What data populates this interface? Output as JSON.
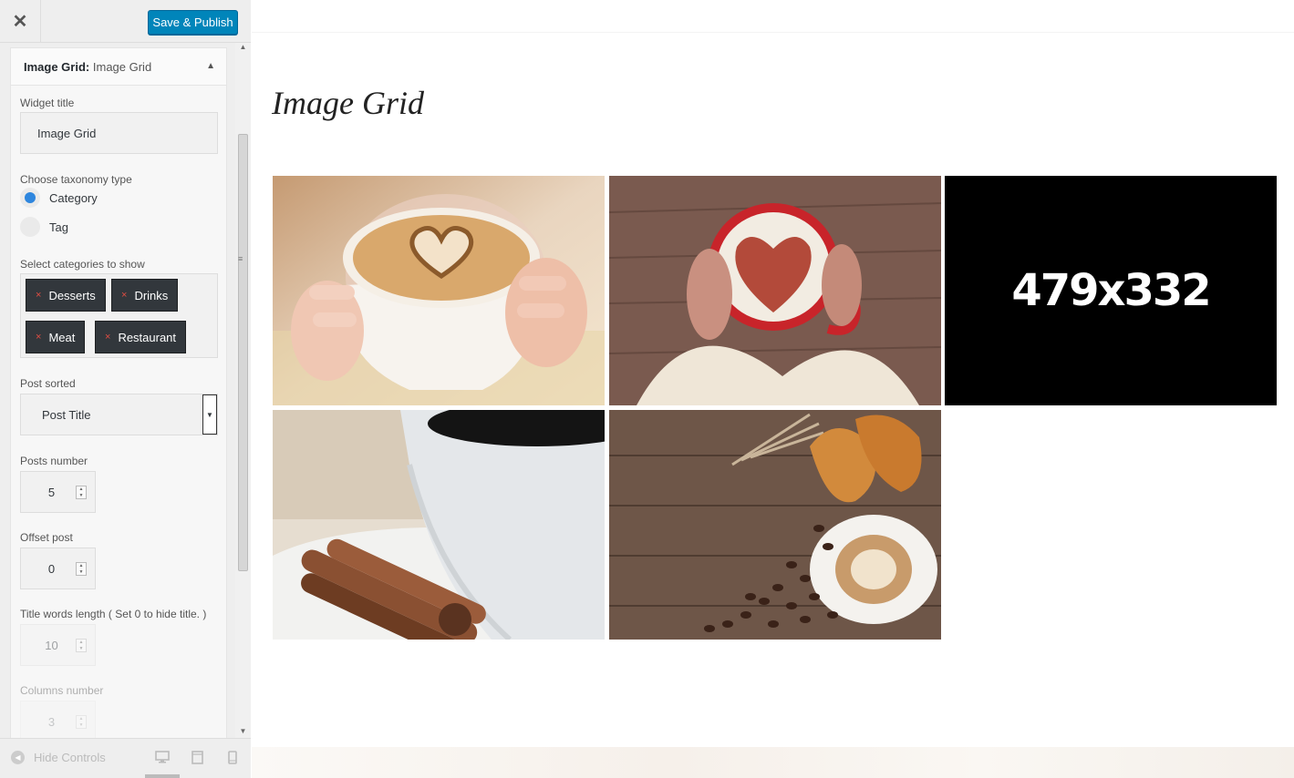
{
  "header": {
    "close_label": "✕",
    "publish_label": "Save & Publish"
  },
  "widget": {
    "title_bold": "Image Grid:",
    "title_name": "Image Grid",
    "toggle": "▲",
    "fields": {
      "widget_title_label": "Widget title",
      "widget_title_value": "Image Grid",
      "taxonomy_label": "Choose taxonomy type",
      "taxonomy_options": [
        {
          "label": "Category",
          "checked": true
        },
        {
          "label": "Tag",
          "checked": false
        }
      ],
      "categories_label": "Select categories to show",
      "categories": [
        "Desserts",
        "Drinks",
        "Meat",
        "Restaurant"
      ],
      "remove_glyph": "×",
      "sorted_label": "Post sorted",
      "sorted_value": "Post Title",
      "posts_number_label": "Posts number",
      "posts_number_value": "5",
      "offset_label": "Offset post",
      "offset_value": "0",
      "title_words_label": "Title words length ( Set 0 to hide title. )",
      "title_words_value": "10",
      "columns_label": "Columns number",
      "columns_value": "3"
    }
  },
  "footer": {
    "hide_controls_label": "Hide Controls",
    "icons": [
      "desktop-icon",
      "tablet-icon",
      "mobile-icon"
    ]
  },
  "preview": {
    "title": "Image Grid",
    "placeholder_text": "479x332",
    "images": [
      {
        "name": "latte-art-heart-hands"
      },
      {
        "name": "red-mug-cocoa-heart"
      },
      {
        "name": "placeholder-479x332"
      },
      {
        "name": "coffee-cup-cinnamon"
      },
      {
        "name": "croissants-coffee-beans"
      }
    ]
  },
  "colors": {
    "accent": "#0085ba",
    "tag_bg": "#32373c",
    "remove_x": "#e14d43",
    "radio_checked": "#2e86de"
  }
}
